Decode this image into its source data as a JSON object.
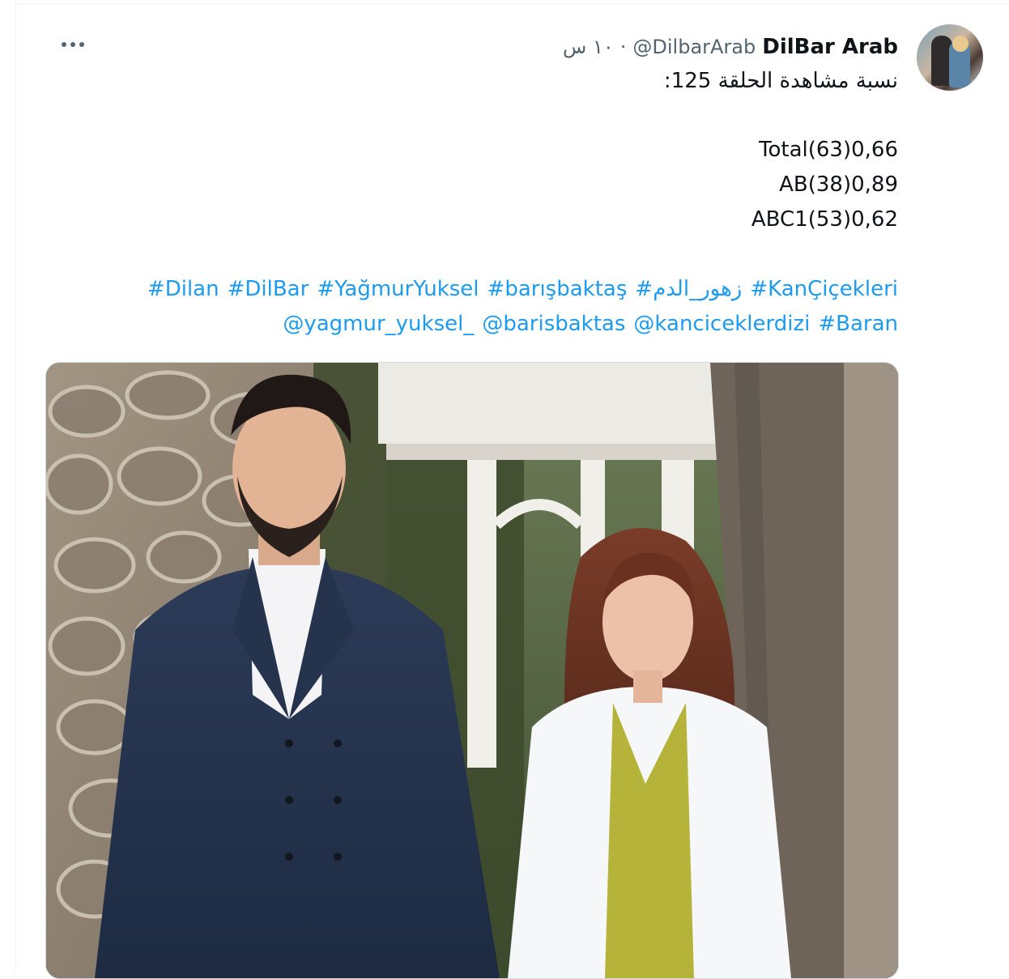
{
  "tweet": {
    "display_name": "DilBar Arab",
    "handle": "@DilbarArab",
    "separator": "·",
    "time": "١٠ س",
    "text_lines": [
      "نسبة مشاهدة الحلقة 125:",
      "Total(63)0,66",
      "AB(38)0,89",
      "ABC1(53)0,62"
    ],
    "hashtags_line1": [
      "#KanÇiçekleri",
      "#زهور_الدم",
      "#barışbaktaş",
      "#YağmurYuksel",
      "#DilBar",
      "#Dilan"
    ],
    "hashtags_line2": [
      "#Baran",
      "@kanciceklerdizi",
      "@barisbaktas",
      "@yagmur_yuksel_"
    ]
  },
  "icons": {
    "more": "more-horizontal-icon"
  },
  "colors": {
    "link": "#1d9bf0",
    "text": "#0f1419",
    "secondary": "#536471",
    "border": "#cfd9de"
  }
}
